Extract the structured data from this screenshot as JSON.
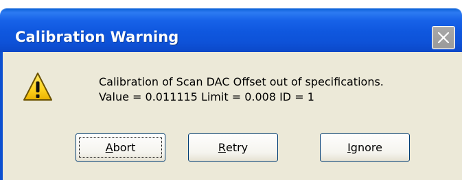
{
  "window": {
    "title": "Calibration Warning",
    "close_icon": "close-icon",
    "close_enabled": false
  },
  "message": {
    "icon": "warning-icon",
    "line1": "Calibration of Scan DAC Offset out of specifications.",
    "line2": "Value = 0.011115  Limit = 0.008  ID = 1"
  },
  "buttons": {
    "abort": {
      "mnemonic": "A",
      "rest": "bort",
      "focused": true
    },
    "retry": {
      "mnemonic": "R",
      "rest": "etry"
    },
    "ignore": {
      "mnemonic": "I",
      "rest": "gnore"
    }
  },
  "colors": {
    "titlebar": "#0e52d8",
    "body": "#ece9d8",
    "button_border": "#003c74"
  }
}
